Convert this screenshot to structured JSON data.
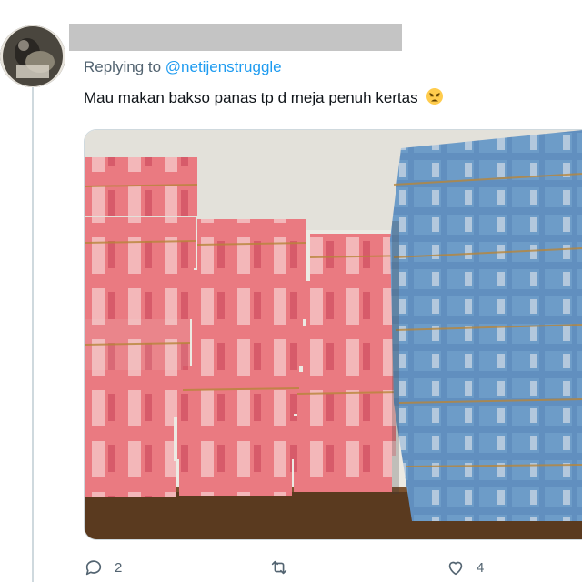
{
  "reply": {
    "replying_prefix": "Replying to",
    "replying_handle": "@netijenstruggle",
    "text": "Mau makan bakso panas tp d meja penuh kertas",
    "emoji": "weary-face"
  },
  "media": {
    "description_icon": "money-stacks-photo",
    "colors": {
      "red_notes": "#e46a72",
      "blue_notes": "#6a98c8",
      "wall": "#eceae3",
      "table": "#5a3a1f"
    }
  },
  "actions": {
    "reply_count": "2",
    "retweet_count": "",
    "like_count": "4"
  },
  "colors": {
    "accent": "#1d9bf0",
    "secondary_text": "#536471",
    "thread_line": "#cfd9de"
  }
}
